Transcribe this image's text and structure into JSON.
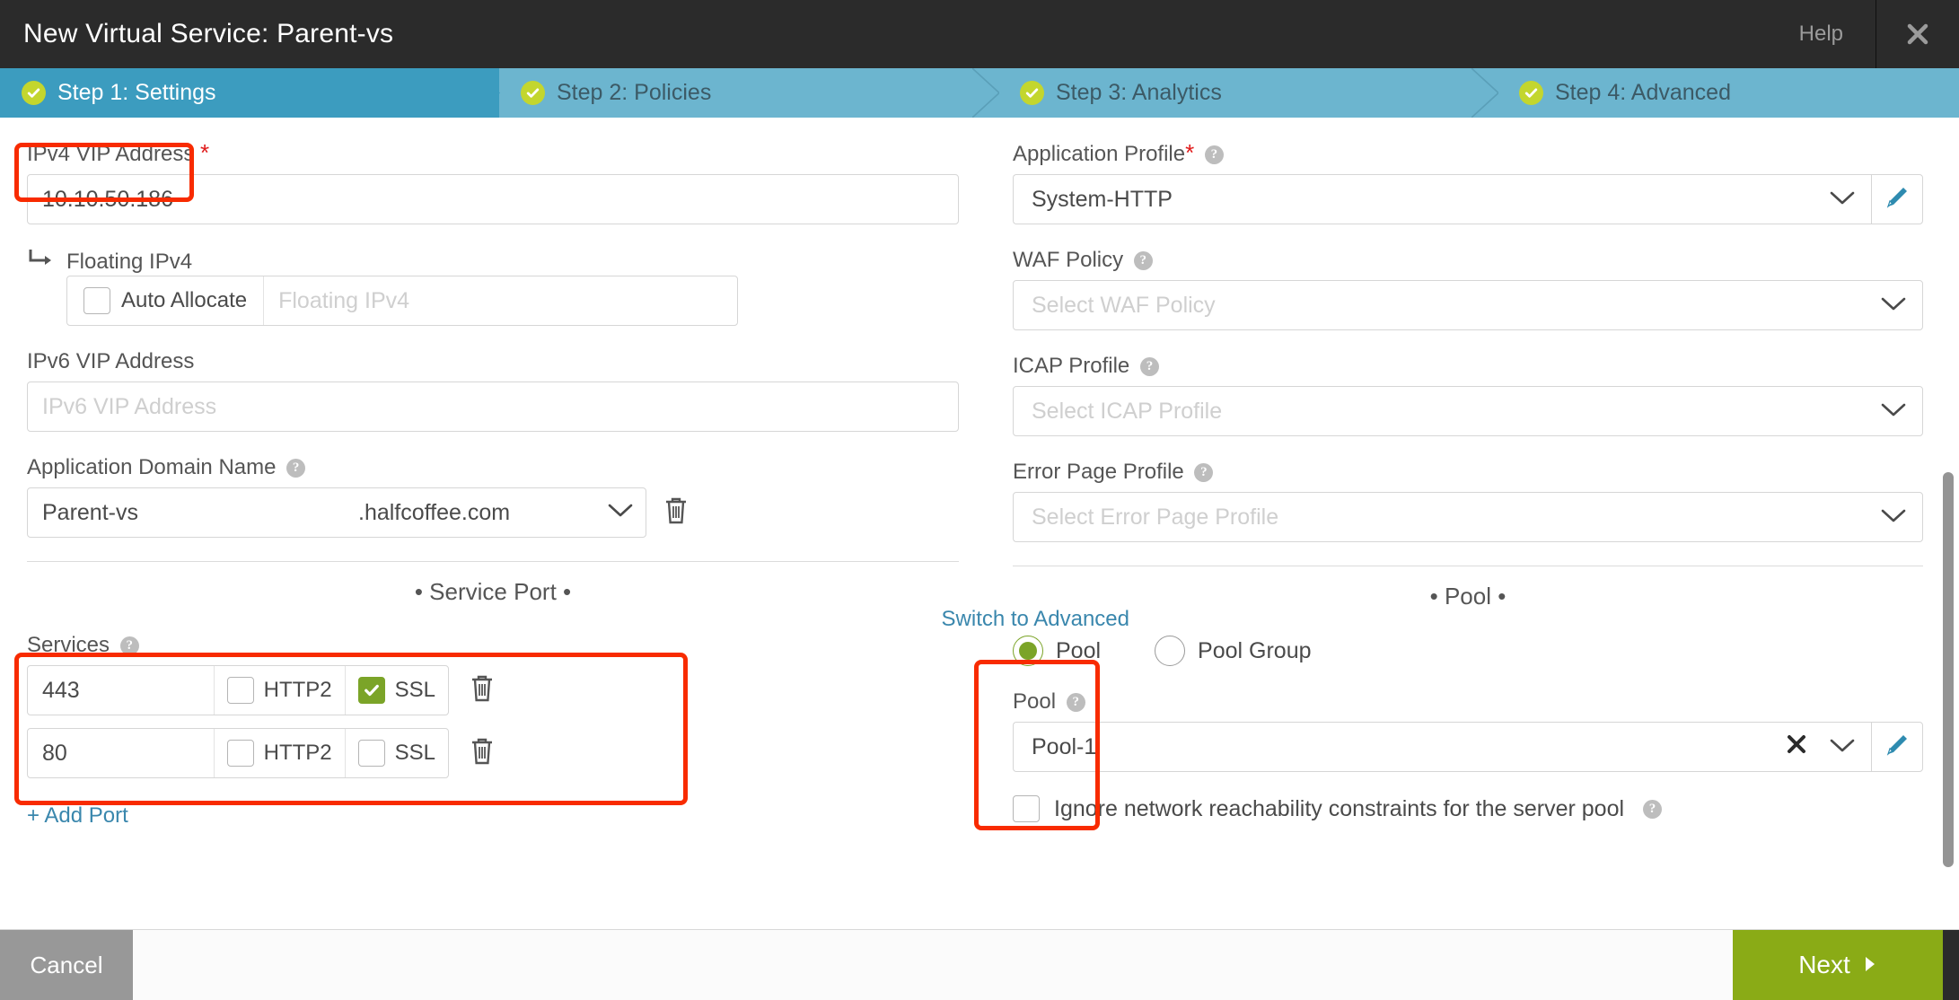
{
  "titlebar": {
    "title": "New Virtual Service: Parent-vs",
    "help_label": "Help",
    "close_icon": "close-icon"
  },
  "steps": [
    {
      "label": "Step 1: Settings",
      "active": true
    },
    {
      "label": "Step 2: Policies",
      "active": false
    },
    {
      "label": "Step 3: Analytics",
      "active": false
    },
    {
      "label": "Step 4: Advanced",
      "active": false
    }
  ],
  "left": {
    "ipv4": {
      "label": "IPv4 VIP Address",
      "required": "*",
      "value": "10.10.50.186"
    },
    "floating_ipv4": {
      "label": "Floating IPv4",
      "auto_allocate_label": "Auto Allocate",
      "auto_allocate_checked": false,
      "placeholder": "Floating IPv4",
      "value": ""
    },
    "ipv6": {
      "label": "IPv6 VIP Address",
      "placeholder": "IPv6 VIP Address",
      "value": ""
    },
    "domain": {
      "label": "Application Domain Name",
      "name": "Parent-vs",
      "suffix": ".halfcoffee.com",
      "delete_icon": "trash-icon"
    },
    "service_port": {
      "section_title": "• Service Port •",
      "switch_link": "Switch to Advanced",
      "services_label": "Services",
      "rows": [
        {
          "port": "443",
          "http2_label": "HTTP2",
          "http2": false,
          "ssl_label": "SSL",
          "ssl": true
        },
        {
          "port": "80",
          "http2_label": "HTTP2",
          "http2": false,
          "ssl_label": "SSL",
          "ssl": false
        }
      ],
      "add_port_label": "+ Add Port"
    }
  },
  "right": {
    "application_profile": {
      "label": "Application Profile",
      "required": "*",
      "value": "System-HTTP",
      "edit_icon": "pencil-icon"
    },
    "waf_policy": {
      "label": "WAF Policy",
      "placeholder": "Select WAF Policy",
      "value": ""
    },
    "icap_profile": {
      "label": "ICAP Profile",
      "placeholder": "Select ICAP Profile",
      "value": ""
    },
    "error_page_profile": {
      "label": "Error Page Profile",
      "placeholder": "Select Error Page Profile",
      "value": ""
    },
    "pool": {
      "section_title": "• Pool •",
      "radio_pool_label": "Pool",
      "radio_pool_group_label": "Pool Group",
      "selected": "Pool",
      "pool_label": "Pool",
      "pool_value": "Pool-1",
      "clear_icon": "close-icon",
      "chevron_icon": "chevron-down-icon",
      "edit_icon": "pencil-icon",
      "ignore_label": "Ignore network reachability constraints for the server pool",
      "ignore_checked": false
    }
  },
  "footer": {
    "cancel_label": "Cancel",
    "next_label": "Next"
  },
  "colors": {
    "titlebar_bg": "#2b2b2b",
    "step_active": "#3c9cbf",
    "step_inactive": "#6cb5cf",
    "step_check": "#c3d62e",
    "accent_link": "#3a87ad",
    "next_button": "#8aab16",
    "cancel_button": "#989898",
    "annotation": "#f82b00",
    "checked_green": "#7ba428"
  }
}
